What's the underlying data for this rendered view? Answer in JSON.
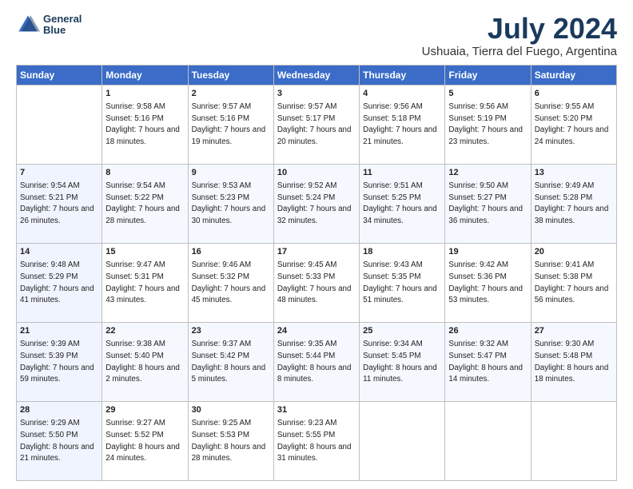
{
  "header": {
    "logo_line1": "General",
    "logo_line2": "Blue",
    "title": "July 2024",
    "subtitle": "Ushuaia, Tierra del Fuego, Argentina"
  },
  "days_of_week": [
    "Sunday",
    "Monday",
    "Tuesday",
    "Wednesday",
    "Thursday",
    "Friday",
    "Saturday"
  ],
  "weeks": [
    [
      {
        "day": "",
        "sunrise": "",
        "sunset": "",
        "daylight": ""
      },
      {
        "day": "1",
        "sunrise": "Sunrise: 9:58 AM",
        "sunset": "Sunset: 5:16 PM",
        "daylight": "Daylight: 7 hours and 18 minutes."
      },
      {
        "day": "2",
        "sunrise": "Sunrise: 9:57 AM",
        "sunset": "Sunset: 5:16 PM",
        "daylight": "Daylight: 7 hours and 19 minutes."
      },
      {
        "day": "3",
        "sunrise": "Sunrise: 9:57 AM",
        "sunset": "Sunset: 5:17 PM",
        "daylight": "Daylight: 7 hours and 20 minutes."
      },
      {
        "day": "4",
        "sunrise": "Sunrise: 9:56 AM",
        "sunset": "Sunset: 5:18 PM",
        "daylight": "Daylight: 7 hours and 21 minutes."
      },
      {
        "day": "5",
        "sunrise": "Sunrise: 9:56 AM",
        "sunset": "Sunset: 5:19 PM",
        "daylight": "Daylight: 7 hours and 23 minutes."
      },
      {
        "day": "6",
        "sunrise": "Sunrise: 9:55 AM",
        "sunset": "Sunset: 5:20 PM",
        "daylight": "Daylight: 7 hours and 24 minutes."
      }
    ],
    [
      {
        "day": "7",
        "sunrise": "Sunrise: 9:54 AM",
        "sunset": "Sunset: 5:21 PM",
        "daylight": "Daylight: 7 hours and 26 minutes."
      },
      {
        "day": "8",
        "sunrise": "Sunrise: 9:54 AM",
        "sunset": "Sunset: 5:22 PM",
        "daylight": "Daylight: 7 hours and 28 minutes."
      },
      {
        "day": "9",
        "sunrise": "Sunrise: 9:53 AM",
        "sunset": "Sunset: 5:23 PM",
        "daylight": "Daylight: 7 hours and 30 minutes."
      },
      {
        "day": "10",
        "sunrise": "Sunrise: 9:52 AM",
        "sunset": "Sunset: 5:24 PM",
        "daylight": "Daylight: 7 hours and 32 minutes."
      },
      {
        "day": "11",
        "sunrise": "Sunrise: 9:51 AM",
        "sunset": "Sunset: 5:25 PM",
        "daylight": "Daylight: 7 hours and 34 minutes."
      },
      {
        "day": "12",
        "sunrise": "Sunrise: 9:50 AM",
        "sunset": "Sunset: 5:27 PM",
        "daylight": "Daylight: 7 hours and 36 minutes."
      },
      {
        "day": "13",
        "sunrise": "Sunrise: 9:49 AM",
        "sunset": "Sunset: 5:28 PM",
        "daylight": "Daylight: 7 hours and 38 minutes."
      }
    ],
    [
      {
        "day": "14",
        "sunrise": "Sunrise: 9:48 AM",
        "sunset": "Sunset: 5:29 PM",
        "daylight": "Daylight: 7 hours and 41 minutes."
      },
      {
        "day": "15",
        "sunrise": "Sunrise: 9:47 AM",
        "sunset": "Sunset: 5:31 PM",
        "daylight": "Daylight: 7 hours and 43 minutes."
      },
      {
        "day": "16",
        "sunrise": "Sunrise: 9:46 AM",
        "sunset": "Sunset: 5:32 PM",
        "daylight": "Daylight: 7 hours and 45 minutes."
      },
      {
        "day": "17",
        "sunrise": "Sunrise: 9:45 AM",
        "sunset": "Sunset: 5:33 PM",
        "daylight": "Daylight: 7 hours and 48 minutes."
      },
      {
        "day": "18",
        "sunrise": "Sunrise: 9:43 AM",
        "sunset": "Sunset: 5:35 PM",
        "daylight": "Daylight: 7 hours and 51 minutes."
      },
      {
        "day": "19",
        "sunrise": "Sunrise: 9:42 AM",
        "sunset": "Sunset: 5:36 PM",
        "daylight": "Daylight: 7 hours and 53 minutes."
      },
      {
        "day": "20",
        "sunrise": "Sunrise: 9:41 AM",
        "sunset": "Sunset: 5:38 PM",
        "daylight": "Daylight: 7 hours and 56 minutes."
      }
    ],
    [
      {
        "day": "21",
        "sunrise": "Sunrise: 9:39 AM",
        "sunset": "Sunset: 5:39 PM",
        "daylight": "Daylight: 7 hours and 59 minutes."
      },
      {
        "day": "22",
        "sunrise": "Sunrise: 9:38 AM",
        "sunset": "Sunset: 5:40 PM",
        "daylight": "Daylight: 8 hours and 2 minutes."
      },
      {
        "day": "23",
        "sunrise": "Sunrise: 9:37 AM",
        "sunset": "Sunset: 5:42 PM",
        "daylight": "Daylight: 8 hours and 5 minutes."
      },
      {
        "day": "24",
        "sunrise": "Sunrise: 9:35 AM",
        "sunset": "Sunset: 5:44 PM",
        "daylight": "Daylight: 8 hours and 8 minutes."
      },
      {
        "day": "25",
        "sunrise": "Sunrise: 9:34 AM",
        "sunset": "Sunset: 5:45 PM",
        "daylight": "Daylight: 8 hours and 11 minutes."
      },
      {
        "day": "26",
        "sunrise": "Sunrise: 9:32 AM",
        "sunset": "Sunset: 5:47 PM",
        "daylight": "Daylight: 8 hours and 14 minutes."
      },
      {
        "day": "27",
        "sunrise": "Sunrise: 9:30 AM",
        "sunset": "Sunset: 5:48 PM",
        "daylight": "Daylight: 8 hours and 18 minutes."
      }
    ],
    [
      {
        "day": "28",
        "sunrise": "Sunrise: 9:29 AM",
        "sunset": "Sunset: 5:50 PM",
        "daylight": "Daylight: 8 hours and 21 minutes."
      },
      {
        "day": "29",
        "sunrise": "Sunrise: 9:27 AM",
        "sunset": "Sunset: 5:52 PM",
        "daylight": "Daylight: 8 hours and 24 minutes."
      },
      {
        "day": "30",
        "sunrise": "Sunrise: 9:25 AM",
        "sunset": "Sunset: 5:53 PM",
        "daylight": "Daylight: 8 hours and 28 minutes."
      },
      {
        "day": "31",
        "sunrise": "Sunrise: 9:23 AM",
        "sunset": "Sunset: 5:55 PM",
        "daylight": "Daylight: 8 hours and 31 minutes."
      },
      {
        "day": "",
        "sunrise": "",
        "sunset": "",
        "daylight": ""
      },
      {
        "day": "",
        "sunrise": "",
        "sunset": "",
        "daylight": ""
      },
      {
        "day": "",
        "sunrise": "",
        "sunset": "",
        "daylight": ""
      }
    ]
  ]
}
